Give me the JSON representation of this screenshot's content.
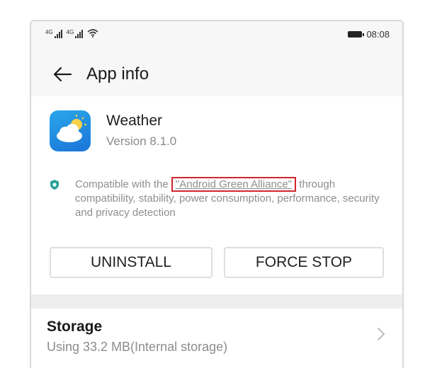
{
  "status_bar": {
    "signal1_tag": "4G",
    "signal2_tag": "4G",
    "time": "08:08"
  },
  "app_bar": {
    "title": "App info"
  },
  "app": {
    "name": "Weather",
    "version": "Version 8.1.0"
  },
  "compatibility": {
    "prefix": "Compatible with the",
    "link": "\"Android Green Alliance\"",
    "suffix": "through compatibility, stability, power consumption, performance, security and privacy detection"
  },
  "actions": {
    "uninstall": "UNINSTALL",
    "force_stop": "FORCE STOP"
  },
  "storage": {
    "title": "Storage",
    "subtitle": "Using 33.2 MB(Internal storage)"
  },
  "colors": {
    "highlight_box": "#d0262d",
    "app_icon": "#1a74d8"
  },
  "icons": [
    "signal-icon",
    "wifi-icon",
    "battery-icon",
    "back-arrow-icon",
    "weather-app-icon",
    "shield-icon",
    "chevron-right-icon"
  ]
}
